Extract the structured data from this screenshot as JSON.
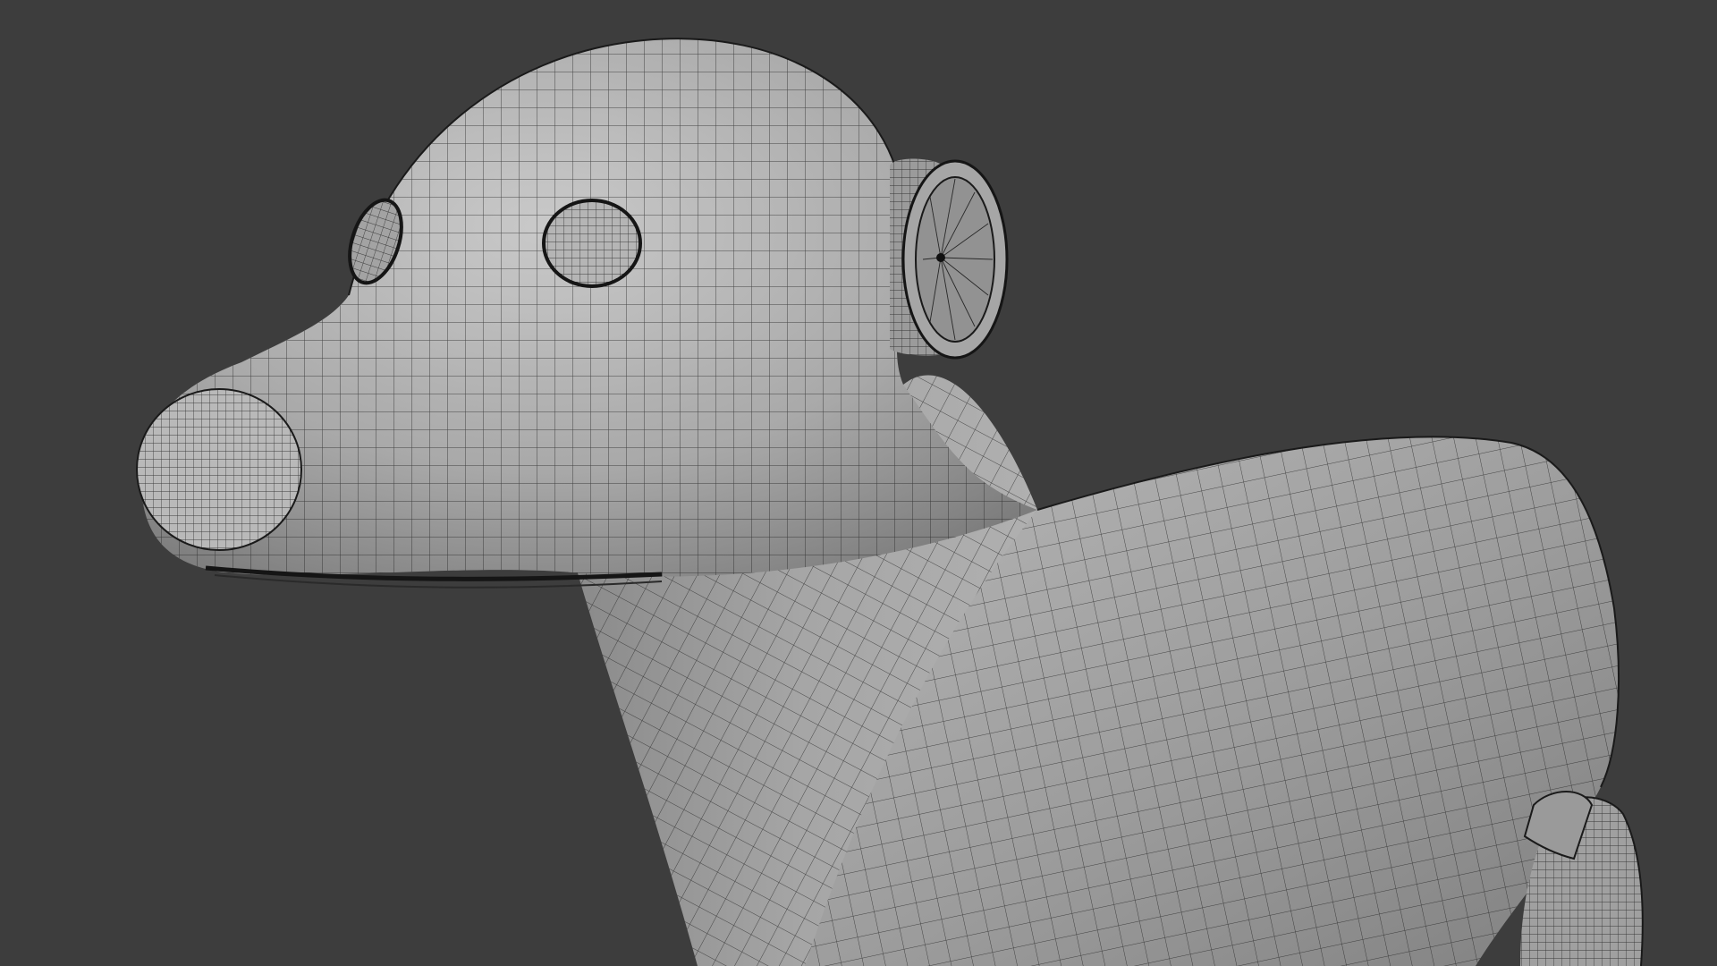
{
  "viewport": {
    "background_color": "#3d3d3d",
    "shading": "solid",
    "overlay": "wireframe"
  },
  "model": {
    "subject": "dog-figure",
    "surface_color": "#a8a8a8",
    "wire_color": "#1e1e1e",
    "parts": [
      "head",
      "snout",
      "nose",
      "eye-left",
      "eye-right",
      "ear-cylinder",
      "neck",
      "body",
      "front-leg"
    ]
  }
}
